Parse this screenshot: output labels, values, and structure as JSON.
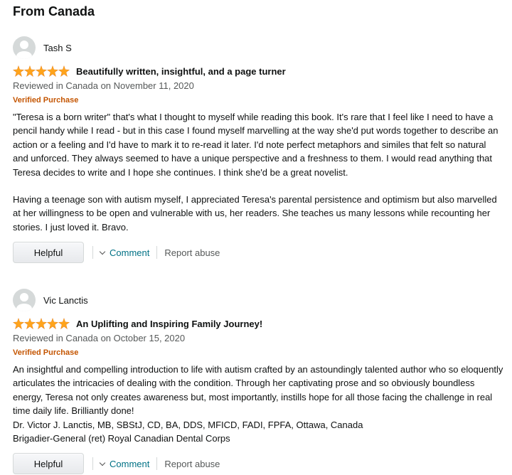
{
  "section_title": "From Canada",
  "colors": {
    "star": "#ffa41c",
    "verified": "#c45500",
    "link": "#007185",
    "muted": "#565959"
  },
  "reviews": [
    {
      "reviewer": "Tash S",
      "rating": 5,
      "title": "Beautifully written, insightful, and a page turner",
      "date": "Reviewed in Canada on November 11, 2020",
      "badge": "Verified Purchase",
      "paragraphs": [
        "\"Teresa is a born writer\" that's what I thought to myself while reading this book. It's rare that I feel like I need to have a pencil handy while I read - but in this case I found myself marvelling at the way she'd put words together to describe an action or a feeling and I'd have to mark it to re-read it later. I'd note perfect metaphors and similes that felt so natural and unforced. They always seemed to have a unique perspective and a freshness to them. I would read anything that Teresa decides to write and I hope she continues. I think she'd be a great novelist.",
        "Having a teenage son with autism myself, I appreciated Teresa's parental persistence and optimism but also marvelled at her willingness to be open and vulnerable with us, her readers. She teaches us many lessons while recounting her stories. I just loved it. Bravo."
      ],
      "helpful_label": "Helpful",
      "comment_label": "Comment",
      "report_label": "Report abuse"
    },
    {
      "reviewer": "Vic Lanctis",
      "rating": 5,
      "title": "An Uplifting and Inspiring Family Journey!",
      "date": "Reviewed in Canada on October 15, 2020",
      "badge": "Verified Purchase",
      "lines": [
        "An insightful and compelling introduction to life with autism crafted by an astoundingly talented author who so eloquently articulates the intricacies of dealing with the condition. Through her captivating prose and so obviously boundless energy, Teresa not only creates awareness but, most importantly, instills hope for all those facing the challenge in real time daily life. Brilliantly done!",
        "Dr. Victor J. Lanctis, MB, SBStJ, CD, BA, DDS, MFICD, FADI, FPFA, Ottawa, Canada",
        "Brigadier-General (ret) Royal Canadian Dental Corps"
      ],
      "helpful_label": "Helpful",
      "comment_label": "Comment",
      "report_label": "Report abuse"
    }
  ]
}
